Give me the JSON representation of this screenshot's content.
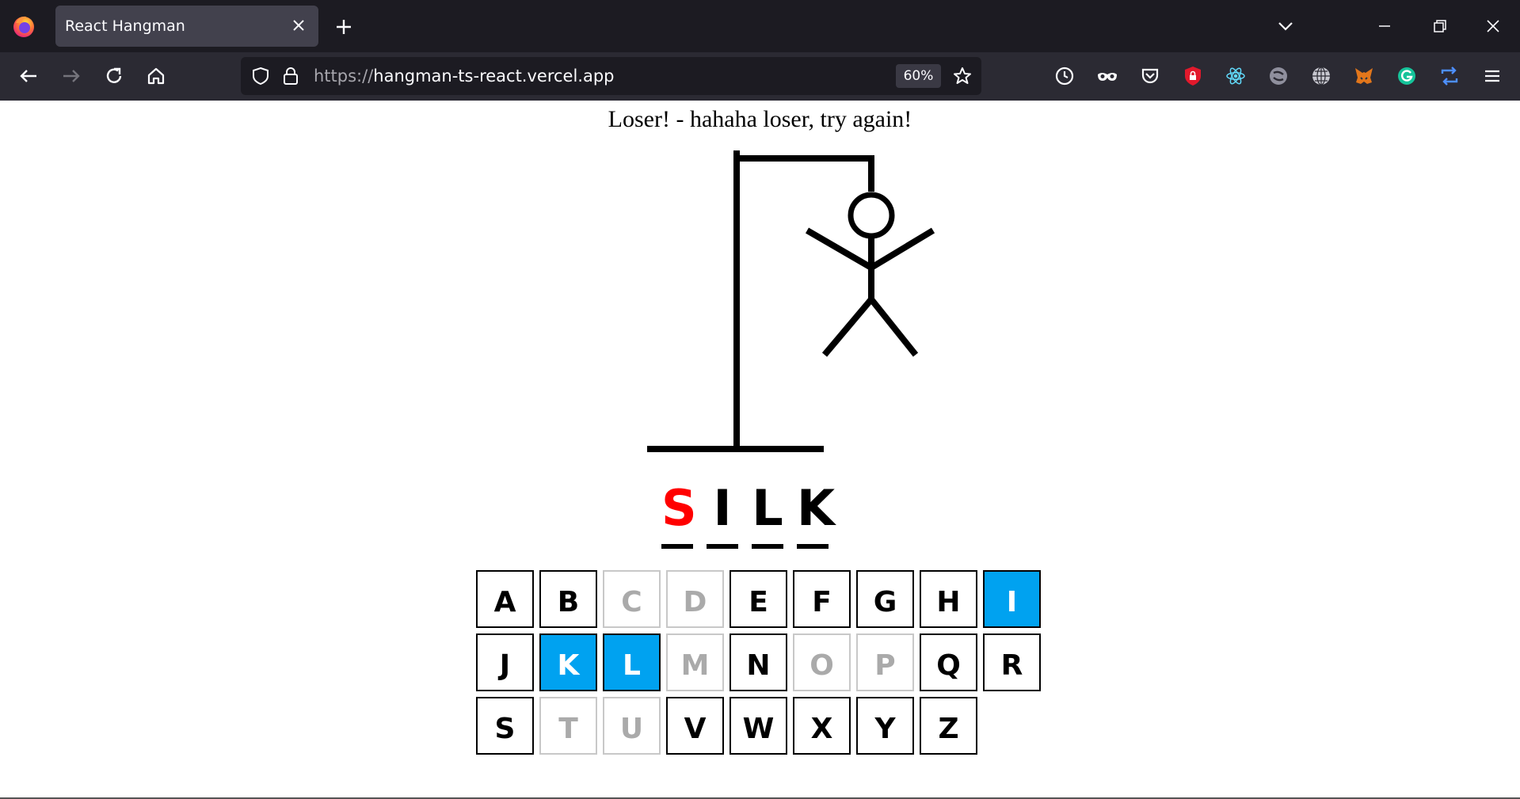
{
  "browser": {
    "tab_title": "React Hangman",
    "url_protocol": "https://",
    "url_host": "hangman-ts-react.vercel.app",
    "zoom": "60%",
    "icons": [
      "firefox-logo-icon",
      "close-icon",
      "plus-icon",
      "chevron-down-icon",
      "minimize-icon",
      "restore-icon",
      "close-window-icon",
      "back-arrow-icon",
      "forward-arrow-icon",
      "reload-icon",
      "home-icon",
      "shield-icon",
      "lock-icon",
      "star-icon",
      "history-icon",
      "private-mask-icon",
      "pocket-icon",
      "shield-red-extension-icon",
      "react-devtools-icon",
      "extension-gray-icon",
      "globe-icon",
      "metamask-fox-icon",
      "grammarly-icon",
      "sync-icon",
      "hamburger-menu-icon"
    ]
  },
  "game": {
    "message": "Loser! - hahaha loser, try again!",
    "word": [
      {
        "letter": "S",
        "color": "#ff0000"
      },
      {
        "letter": "I",
        "color": "#000000"
      },
      {
        "letter": "L",
        "color": "#000000"
      },
      {
        "letter": "K",
        "color": "#000000"
      }
    ],
    "keys": [
      {
        "letter": "A",
        "state": "available"
      },
      {
        "letter": "B",
        "state": "available"
      },
      {
        "letter": "C",
        "state": "used"
      },
      {
        "letter": "D",
        "state": "used"
      },
      {
        "letter": "E",
        "state": "available"
      },
      {
        "letter": "F",
        "state": "available"
      },
      {
        "letter": "G",
        "state": "available"
      },
      {
        "letter": "H",
        "state": "available"
      },
      {
        "letter": "I",
        "state": "correct"
      },
      {
        "letter": "J",
        "state": "available"
      },
      {
        "letter": "K",
        "state": "correct"
      },
      {
        "letter": "L",
        "state": "correct"
      },
      {
        "letter": "M",
        "state": "used"
      },
      {
        "letter": "N",
        "state": "available"
      },
      {
        "letter": "O",
        "state": "used"
      },
      {
        "letter": "P",
        "state": "used"
      },
      {
        "letter": "Q",
        "state": "available"
      },
      {
        "letter": "R",
        "state": "available"
      },
      {
        "letter": "S",
        "state": "available"
      },
      {
        "letter": "T",
        "state": "used"
      },
      {
        "letter": "U",
        "state": "used"
      },
      {
        "letter": "V",
        "state": "available"
      },
      {
        "letter": "W",
        "state": "available"
      },
      {
        "letter": "X",
        "state": "available"
      },
      {
        "letter": "Y",
        "state": "available"
      },
      {
        "letter": "Z",
        "state": "available"
      }
    ],
    "colors": {
      "correct_key": "#00a2f0",
      "missed_letter": "#ff0000"
    }
  }
}
